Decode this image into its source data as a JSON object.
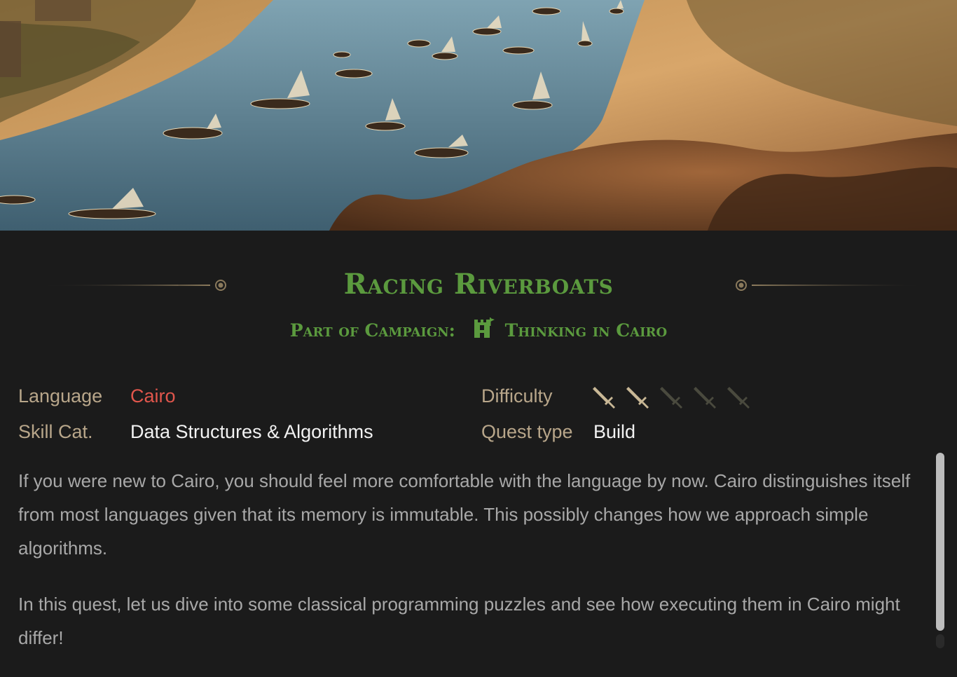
{
  "quest": {
    "title": "Racing Riverboats",
    "campaign_prefix": "Part of Campaign:",
    "campaign_name": "Thinking in Cairo"
  },
  "meta": {
    "language_label": "Language",
    "language_value": "Cairo",
    "skill_label": "Skill Cat.",
    "skill_value": "Data Structures & Algorithms",
    "difficulty_label": "Difficulty",
    "difficulty_level": 2,
    "difficulty_max": 5,
    "quest_type_label": "Quest type",
    "quest_type_value": "Build"
  },
  "description": {
    "p1": "If you were new to Cairo, you should feel more comfortable with the language by now. Cairo distin­guishes itself from most languages given that its memory is immutable. This possibly changes how we approach simple algorithms.",
    "p2": "In this quest, let us dive into some classical programming puzzles and see how executing them in Cairo might differ!"
  },
  "colors": {
    "title_green": "#5b9a3e",
    "label_tan": "#b8a68a",
    "language_red": "#e0564c",
    "text_light": "#f2f2f2",
    "body_gray": "#a8a8a8",
    "background": "#1b1b1b"
  },
  "icons": {
    "campaign": "castle-icon",
    "difficulty": "sword-icon"
  }
}
